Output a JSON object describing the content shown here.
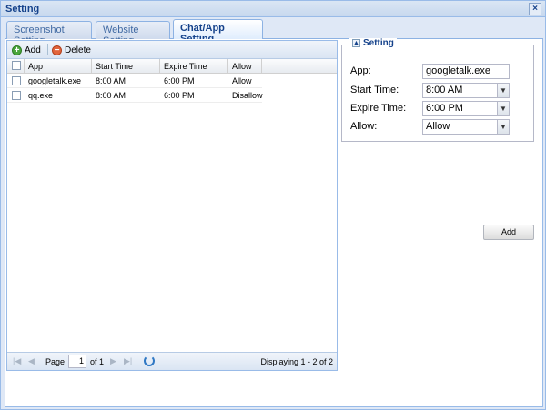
{
  "window": {
    "title": "Setting",
    "close_glyph": "×"
  },
  "tabs": [
    {
      "label": "Screenshot Setting",
      "active": false
    },
    {
      "label": "Website Setting",
      "active": false
    },
    {
      "label": "Chat/App Setting",
      "active": true
    }
  ],
  "toolbar": {
    "add_label": "Add",
    "add_icon": "plus-circle-icon",
    "delete_label": "Delete",
    "delete_icon": "minus-circle-icon"
  },
  "grid": {
    "columns": [
      "App",
      "Start Time",
      "Expire Time",
      "Allow"
    ],
    "rows": [
      {
        "app": "googletalk.exe",
        "start": "8:00 AM",
        "expire": "6:00 PM",
        "allow": "Allow"
      },
      {
        "app": "qq.exe",
        "start": "8:00 AM",
        "expire": "6:00 PM",
        "allow": "Disallow"
      }
    ]
  },
  "pager": {
    "page_label": "Page",
    "page_value": "1",
    "of_label": "of 1",
    "displaying": "Displaying 1 - 2 of 2",
    "first_glyph": "|◀",
    "prev_glyph": "◀",
    "next_glyph": "▶",
    "last_glyph": "▶|"
  },
  "form": {
    "legend": "Setting",
    "toggle_glyph": "▲",
    "app_label": "App:",
    "app_value": "googletalk.exe",
    "start_label": "Start Time:",
    "start_value": "8:00 AM",
    "expire_label": "Expire Time:",
    "expire_value": "6:00 PM",
    "allow_label": "Allow:",
    "allow_value": "Allow",
    "dropdown_glyph": "▼",
    "add_button": "Add"
  },
  "colors": {
    "accent": "#15428b",
    "border": "#99bbe8",
    "panel_bg": "#dfe8f6"
  }
}
